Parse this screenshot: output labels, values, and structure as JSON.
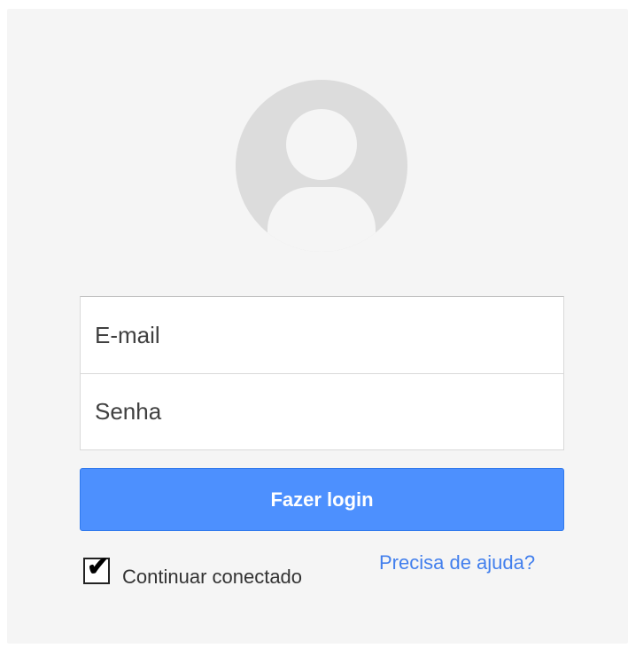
{
  "login": {
    "email_placeholder": "E-mail",
    "password_placeholder": "Senha",
    "submit_label": "Fazer login",
    "remember_label": "Continuar conectado",
    "remember_checked": true,
    "help_link": "Precisa de ajuda?"
  },
  "colors": {
    "card_background": "#f5f5f5",
    "avatar_background": "#dcdcdc",
    "button_blue": "#4d90fe",
    "link_blue": "#427fed"
  }
}
